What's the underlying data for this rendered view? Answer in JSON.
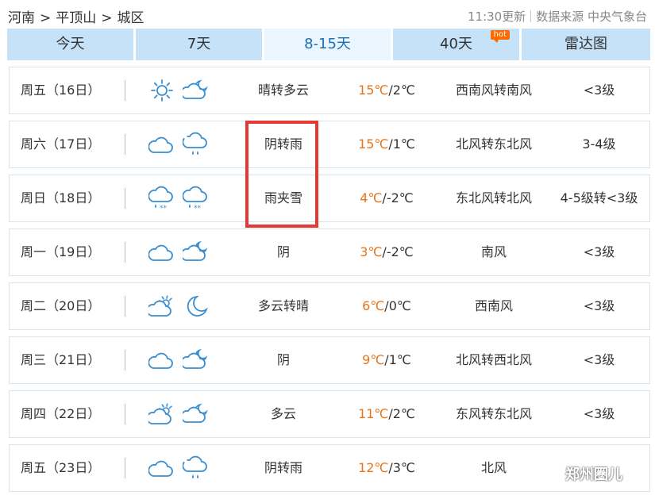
{
  "breadcrumb": {
    "province": "河南",
    "city": "平顶山",
    "district": "城区",
    "sep": ">"
  },
  "meta": {
    "updated": "11:30更新",
    "source": "数据来源 中央气象台"
  },
  "tabs": [
    {
      "label": "今天"
    },
    {
      "label": "7天"
    },
    {
      "label": "8-15天"
    },
    {
      "label": "40天",
      "badge": "hot"
    },
    {
      "label": "雷达图"
    }
  ],
  "active_tab": "8-15天",
  "colors": {
    "accent": "#1a6fb5",
    "tab_bg": "#c5e2f8",
    "high_temp": "#e8741a",
    "highlight_box": "#e53935"
  },
  "forecast": [
    {
      "day": "周五（16日）",
      "icon_day": "sunny-icon",
      "icon_night": "partly-cloudy-night-icon",
      "desc": "晴转多云",
      "high": "15℃",
      "low": "/2℃",
      "wind": "西南风转南风",
      "level": "<3级"
    },
    {
      "day": "周六（17日）",
      "icon_day": "cloudy-icon",
      "icon_night": "rain-icon",
      "desc": "阴转雨",
      "high": "15℃",
      "low": "/1℃",
      "wind": "北风转东北风",
      "level": "3-4级"
    },
    {
      "day": "周日（18日）",
      "icon_day": "sleet-icon",
      "icon_night": "sleet-icon",
      "desc": "雨夹雪",
      "high": "4℃",
      "low": "/-2℃",
      "wind": "东北风转北风",
      "level": "4-5级转<3级"
    },
    {
      "day": "周一（19日）",
      "icon_day": "cloudy-icon",
      "icon_night": "cloudy-night-icon",
      "desc": "阴",
      "high": "3℃",
      "low": "/-2℃",
      "wind": "南风",
      "level": "<3级"
    },
    {
      "day": "周二（20日）",
      "icon_day": "partly-cloudy-day-icon",
      "icon_night": "clear-night-icon",
      "desc": "多云转晴",
      "high": "6℃",
      "low": "/0℃",
      "wind": "西南风",
      "level": "<3级"
    },
    {
      "day": "周三（21日）",
      "icon_day": "cloudy-icon",
      "icon_night": "cloudy-night-icon",
      "desc": "阴",
      "high": "9℃",
      "low": "/1℃",
      "wind": "北风转西北风",
      "level": "<3级"
    },
    {
      "day": "周四（22日）",
      "icon_day": "partly-cloudy-day-icon",
      "icon_night": "partly-cloudy-night-icon",
      "desc": "多云",
      "high": "11℃",
      "low": "/2℃",
      "wind": "东风转东北风",
      "level": "<3级"
    },
    {
      "day": "周五（23日）",
      "icon_day": "cloudy-icon",
      "icon_night": "rain-icon",
      "desc": "阴转雨",
      "high": "12℃",
      "low": "/3℃",
      "wind": "北风",
      "level": ""
    }
  ],
  "watermark": "郑州圈儿"
}
